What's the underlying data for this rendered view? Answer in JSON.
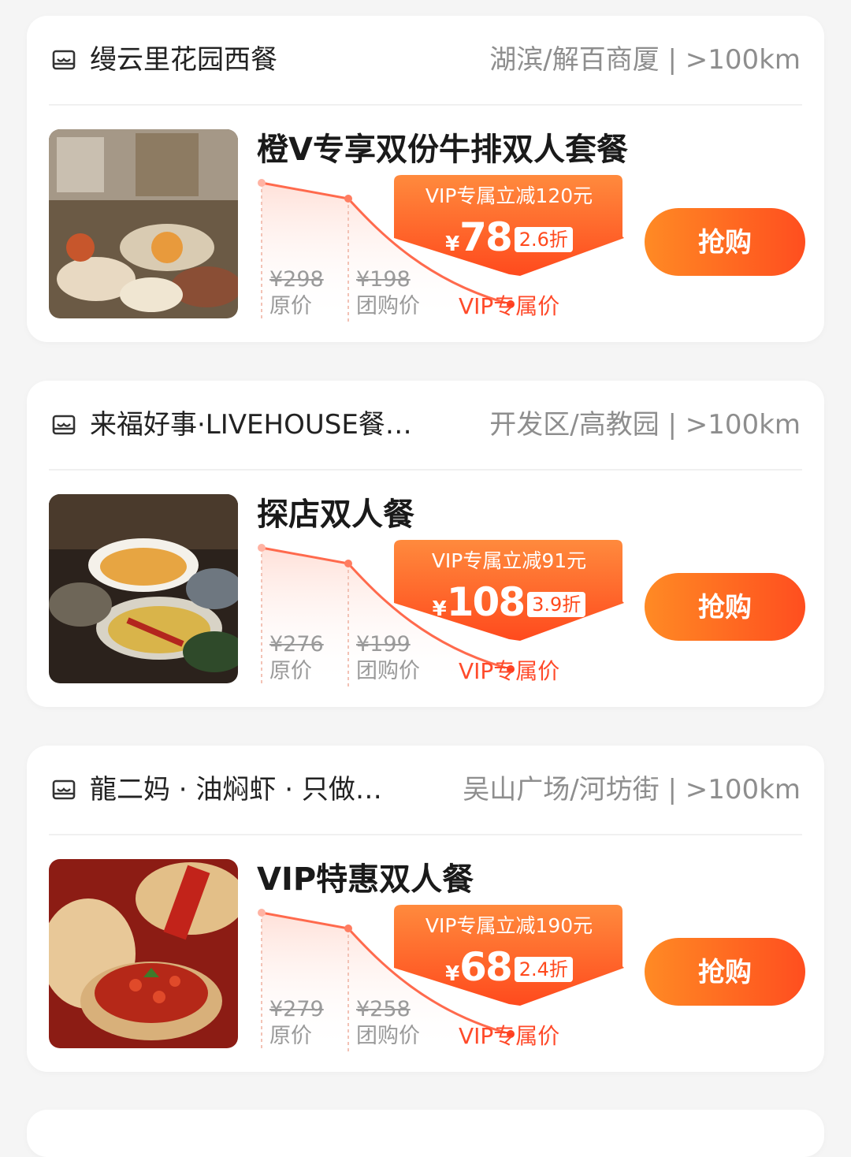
{
  "cards": [
    {
      "shop_name": "缦云里花园西餐",
      "shop_meta": "湖滨/解百商厦 | >100km",
      "deal_title": "橙V专享双份牛排双人套餐",
      "vip_discount_text": "VIP专属立减120元",
      "currency": "¥",
      "vip_price": "78",
      "discount_rate": "2.6折",
      "original_price": "¥298",
      "original_label": "原价",
      "group_price": "¥198",
      "group_label": "团购价",
      "vip_label": "VIP专属价",
      "buy_label": "抢购",
      "image_desc_icon": "western-food-photo"
    },
    {
      "shop_name": "来福好事·LIVEHOUSE餐…",
      "shop_meta": "开发区/高教园 | >100km",
      "deal_title": "探店双人餐",
      "vip_discount_text": "VIP专属立减91元",
      "currency": "¥",
      "vip_price": "108",
      "discount_rate": "3.9折",
      "original_price": "¥276",
      "original_label": "原价",
      "group_price": "¥199",
      "group_label": "团购价",
      "vip_label": "VIP专属价",
      "buy_label": "抢购",
      "image_desc_icon": "chinese-dishes-photo"
    },
    {
      "shop_name": "龍二妈 · 油焖虾 · 只做…",
      "shop_meta": "吴山广场/河坊街 | >100km",
      "deal_title": "VIP特惠双人餐",
      "vip_discount_text": "VIP专属立减190元",
      "currency": "¥",
      "vip_price": "68",
      "discount_rate": "2.4折",
      "original_price": "¥279",
      "original_label": "原价",
      "group_price": "¥258",
      "group_label": "团购价",
      "vip_label": "VIP专属价",
      "buy_label": "抢购",
      "image_desc_icon": "crayfish-photo"
    }
  ],
  "colors": {
    "accent": "#ff4e1f",
    "accent_light": "#ff8a24",
    "vip_text": "#ff4a2a"
  },
  "icons": {
    "shop": "storefront-icon"
  }
}
